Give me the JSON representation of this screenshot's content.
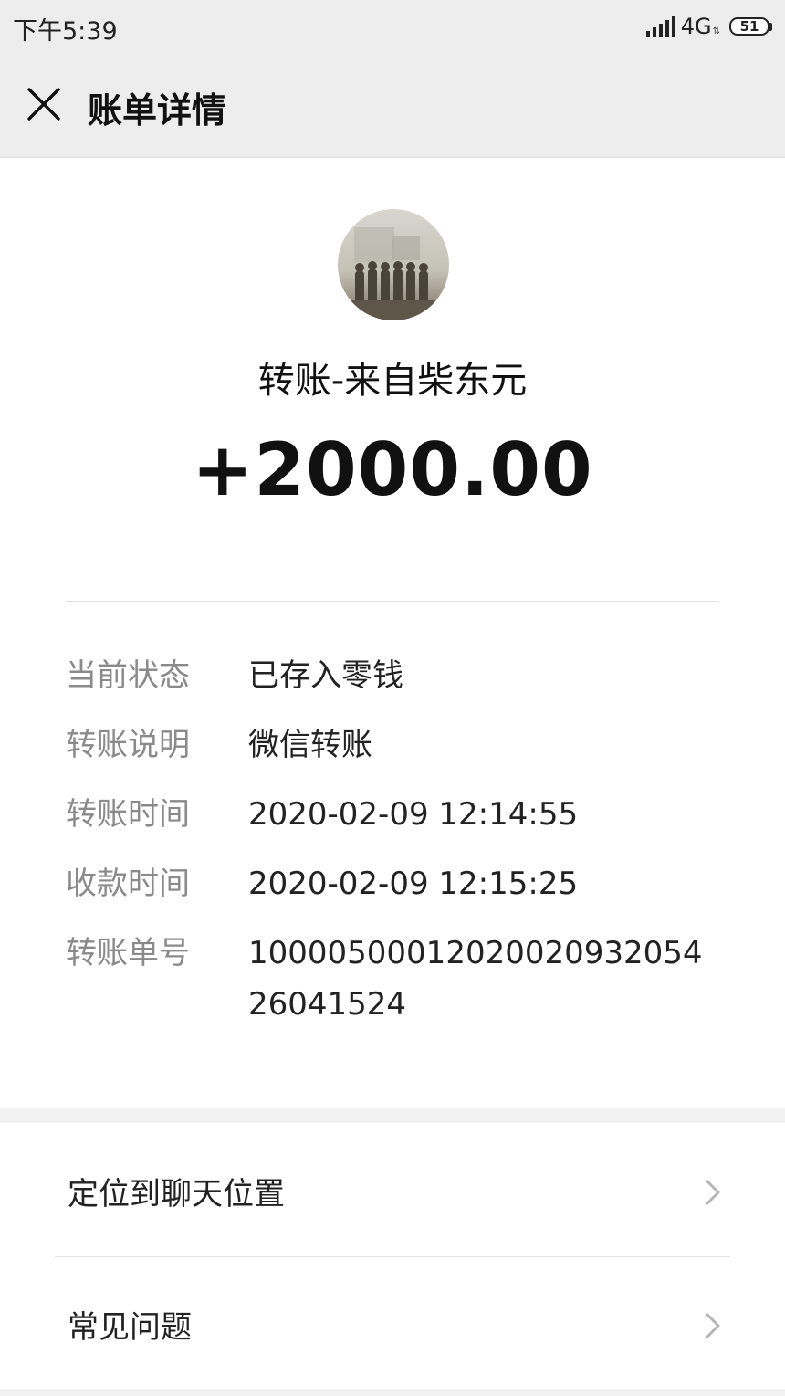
{
  "status_bar": {
    "time": "下午5:39",
    "network": "4G",
    "battery": "51"
  },
  "header": {
    "title": "账单详情",
    "close_icon": "close-icon"
  },
  "transaction": {
    "title": "转账-来自柴东元",
    "amount": "+2000.00"
  },
  "details": [
    {
      "label": "当前状态",
      "value": "已存入零钱"
    },
    {
      "label": "转账说明",
      "value": "微信转账"
    },
    {
      "label": "转账时间",
      "value": "2020-02-09 12:14:55"
    },
    {
      "label": "收款时间",
      "value": "2020-02-09 12:15:25"
    },
    {
      "label": "转账单号",
      "value": "1000050001202002093205426041524"
    }
  ],
  "menu": {
    "locate_label": "定位到聊天位置",
    "faq_label": "常见问题",
    "chevron_icon": "chevron-right-icon"
  },
  "colors": {
    "header_bg": "#ededed",
    "label_gray": "#8a8a8a",
    "text": "#111111"
  }
}
